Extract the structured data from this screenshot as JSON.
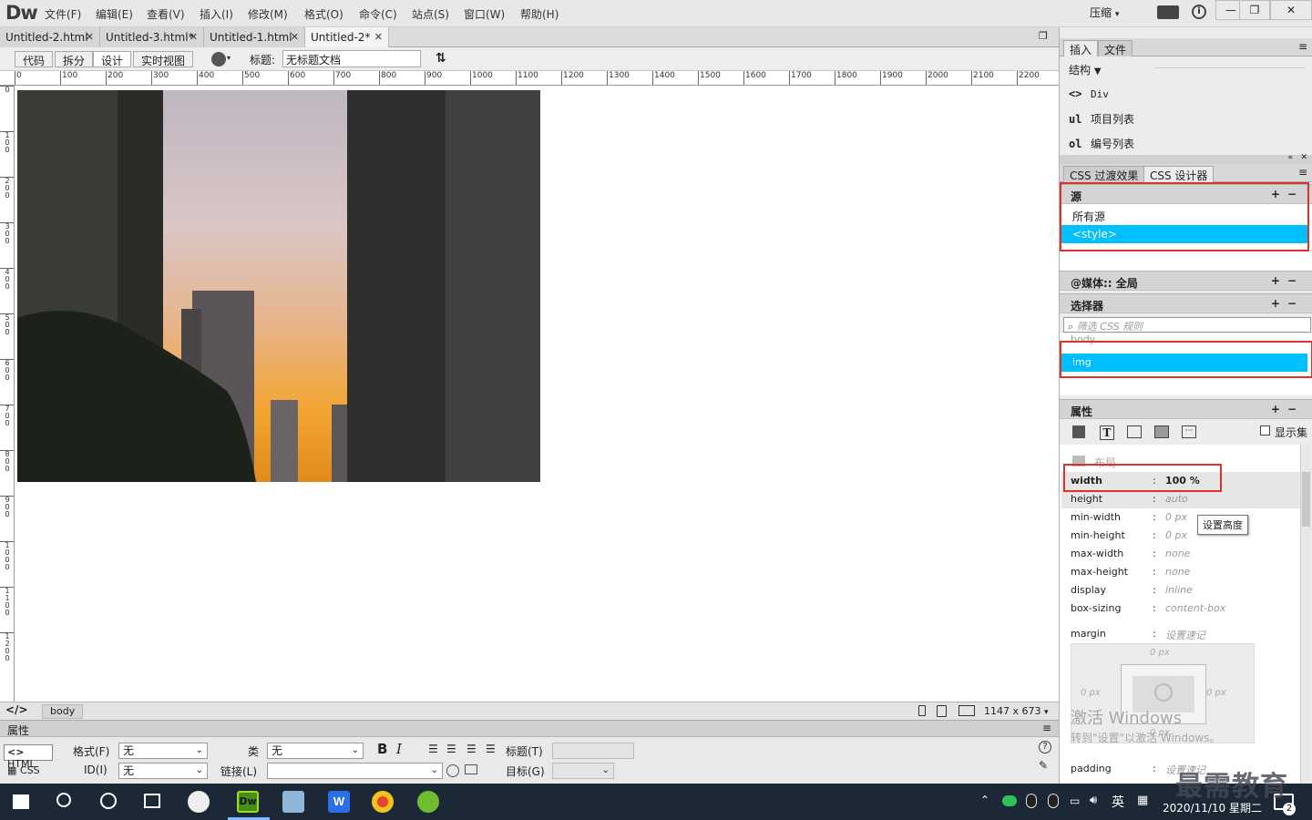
{
  "app": {
    "logo": "Dw",
    "collapse_label": "压缩"
  },
  "menus": [
    "文件(F)",
    "编辑(E)",
    "查看(V)",
    "插入(I)",
    "修改(M)",
    "格式(O)",
    "命令(C)",
    "站点(S)",
    "窗口(W)",
    "帮助(H)"
  ],
  "tabs": [
    {
      "label": "Untitled-2.html"
    },
    {
      "label": "Untitled-3.html*"
    },
    {
      "label": "Untitled-1.html"
    },
    {
      "label": "Untitled-2*",
      "active": true
    }
  ],
  "toolbar": {
    "code": "代码",
    "split": "拆分",
    "design": "设计",
    "live": "实时视图",
    "title_label": "标题:",
    "title_value": "无标题文档"
  },
  "ruler": {
    "h_ticks": [
      "0",
      "100",
      "200",
      "300",
      "400",
      "500",
      "600",
      "700",
      "800",
      "900",
      "1000",
      "1100",
      "1200",
      "1300",
      "1400",
      "1500",
      "1600",
      "1700",
      "1800",
      "1900",
      "2000",
      "2100",
      "2200"
    ],
    "v_ticks": [
      "0",
      "100",
      "200",
      "300",
      "400",
      "500",
      "600",
      "700",
      "800",
      "900",
      "1000",
      "1100",
      "1200"
    ]
  },
  "status": {
    "tag": "body",
    "size": "1147 x 673"
  },
  "properties_bar": {
    "header": "属性",
    "html_btn": "HTML",
    "css_btn": "CSS",
    "format_label": "格式(F)",
    "format_value": "无",
    "class_label": "类",
    "class_value": "无",
    "id_label": "ID(I)",
    "id_value": "无",
    "link_label": "链接(L)",
    "title_label": "标题(T)",
    "target_label": "目标(G)"
  },
  "insert_panel": {
    "tab_insert": "插入",
    "tab_files": "文件",
    "category": "结构",
    "items": [
      {
        "icon": "<>",
        "label": "Div"
      },
      {
        "icon": "ul",
        "label": "项目列表"
      },
      {
        "icon": "ol",
        "label": "编号列表"
      }
    ]
  },
  "css_panel": {
    "tab_transitions": "CSS 过渡效果",
    "tab_designer": "CSS 设计器",
    "source_head": "源",
    "sources": [
      "所有源",
      "<style>"
    ],
    "media_head": "@媒体:: 全局",
    "selector_head": "选择器",
    "filter_placeholder": "筛选 CSS 规则",
    "selectors": [
      "body",
      "img"
    ],
    "props_head": "属性",
    "show_set": "显示集",
    "layout_label": "布局",
    "props": [
      {
        "k": "width",
        "v": "100 %"
      },
      {
        "k": "height",
        "v": "auto"
      },
      {
        "k": "min-width",
        "v": "0 px"
      },
      {
        "k": "min-height",
        "v": "0 px"
      },
      {
        "k": "max-width",
        "v": "none"
      },
      {
        "k": "max-height",
        "v": "none"
      },
      {
        "k": "display",
        "v": "inline"
      },
      {
        "k": "box-sizing",
        "v": "content-box"
      }
    ],
    "tooltip": "设置高度",
    "margin_label": "margin",
    "margin_shorthand": "设置速记",
    "margin_top": "0 px",
    "margin_left": "0 px",
    "margin_right": "0 px",
    "margin_bottom": "0 px",
    "padding_label": "padding",
    "padding_shorthand": "设置速记",
    "watermark1": "激活 Windows",
    "watermark2": "转到\"设置\"以激活 Windows。"
  },
  "taskbar": {
    "ime": "英",
    "clock": "2020/11/10 星期二",
    "notif_count": "2",
    "brand_watermark": "最需教育"
  }
}
